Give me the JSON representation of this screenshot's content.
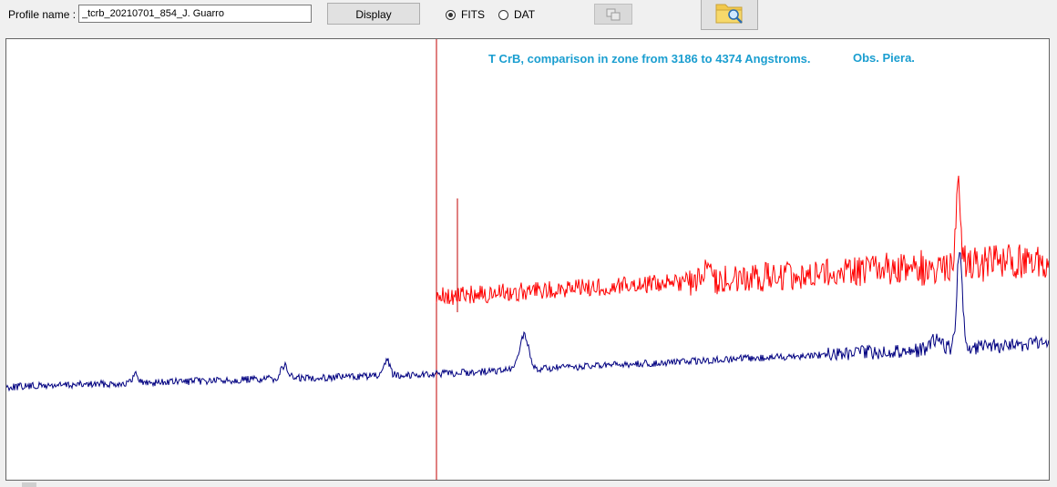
{
  "toolbar": {
    "profile_label": "Profile name :",
    "profile_value": "_tcrb_20210701_854_J. Guarro",
    "display_button": "Display",
    "format_options": [
      {
        "label": "FITS",
        "selected": true
      },
      {
        "label": "DAT",
        "selected": false
      }
    ],
    "copy_button_icon": "copy-icon",
    "open_button_icon": "folder-search-icon"
  },
  "plot": {
    "title": "T CrB, comparison in zone from 3186 to 4374 Angstroms.",
    "observer": "Obs. Piera."
  },
  "colors": {
    "title": "#1a9ed0",
    "series_1": "#ff0000",
    "series_2": "#000080",
    "marker": "#c00000"
  }
}
